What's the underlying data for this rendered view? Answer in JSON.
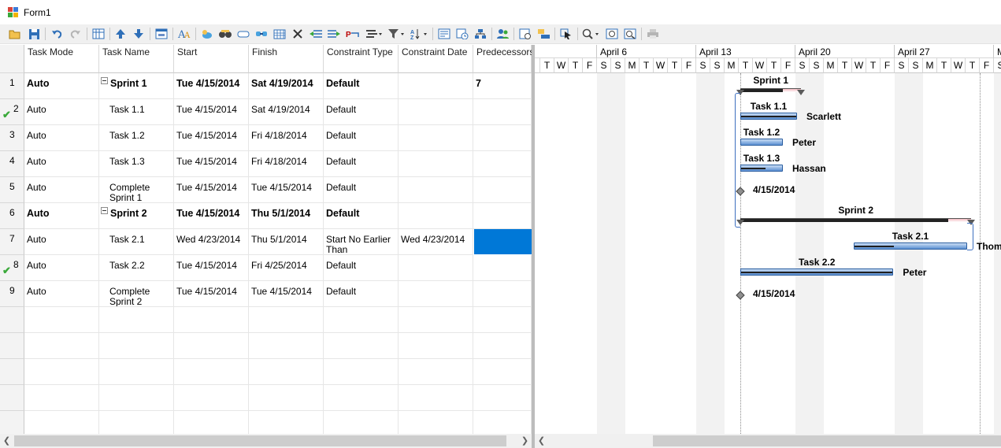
{
  "window": {
    "title": "Form1",
    "icon": "form-window-icon"
  },
  "toolbar": {
    "buttons": [
      "open-icon",
      "save-icon",
      "undo-icon",
      "redo-icon",
      "grid-columns-icon",
      "move-up-icon",
      "move-down-icon",
      "window-icon",
      "font-icon",
      "cloud-icon",
      "binoculars-icon",
      "capsule-icon",
      "link-tasks-icon",
      "calendar-icon",
      "delete-icon",
      "outdent-icon",
      "indent-icon",
      "resource-icon",
      "bar-style-icon",
      "filter-icon",
      "sort-icon",
      "report-icon",
      "schedule-icon",
      "org-icon",
      "users-icon",
      "task-info-icon",
      "notes-icon",
      "pointer-icon",
      "zoom-icon",
      "zoom-fit-icon",
      "zoom-time-icon",
      "print-icon"
    ]
  },
  "grid": {
    "columns": [
      "Task Mode",
      "Task Name",
      "Start",
      "Finish",
      "Constraint Type",
      "Constraint Date",
      "Predecessors"
    ],
    "rows": [
      {
        "num": "1",
        "mode": "Auto",
        "name": "Sprint 1",
        "start": "Tue 4/15/2014",
        "finish": "Sat 4/19/2014",
        "ctype": "Default",
        "cdate": "",
        "pred": "7",
        "summary": true,
        "check": false,
        "indent": false
      },
      {
        "num": "2",
        "mode": "Auto",
        "name": "Task 1.1",
        "start": "Tue 4/15/2014",
        "finish": "Sat 4/19/2014",
        "ctype": "Default",
        "cdate": "",
        "pred": "",
        "summary": false,
        "check": true,
        "indent": true
      },
      {
        "num": "3",
        "mode": "Auto",
        "name": "Task 1.2",
        "start": "Tue 4/15/2014",
        "finish": "Fri 4/18/2014",
        "ctype": "Default",
        "cdate": "",
        "pred": "",
        "summary": false,
        "check": false,
        "indent": true
      },
      {
        "num": "4",
        "mode": "Auto",
        "name": "Task 1.3",
        "start": "Tue 4/15/2014",
        "finish": "Fri 4/18/2014",
        "ctype": "Default",
        "cdate": "",
        "pred": "",
        "summary": false,
        "check": false,
        "indent": true
      },
      {
        "num": "5",
        "mode": "Auto",
        "name": "Complete Sprint 1",
        "start": "Tue 4/15/2014",
        "finish": "Tue 4/15/2014",
        "ctype": "Default",
        "cdate": "",
        "pred": "",
        "summary": false,
        "check": false,
        "indent": true
      },
      {
        "num": "6",
        "mode": "Auto",
        "name": "Sprint 2",
        "start": "Tue 4/15/2014",
        "finish": "Thu 5/1/2014",
        "ctype": "Default",
        "cdate": "",
        "pred": "",
        "summary": true,
        "check": false,
        "indent": false
      },
      {
        "num": "7",
        "mode": "Auto",
        "name": "Task 2.1",
        "start": "Wed 4/23/2014",
        "finish": "Thu 5/1/2014",
        "ctype": "Start No Earlier Than",
        "cdate": "Wed 4/23/2014",
        "pred": "",
        "summary": false,
        "check": false,
        "indent": true,
        "selected": true
      },
      {
        "num": "8",
        "mode": "Auto",
        "name": "Task 2.2",
        "start": "Tue 4/15/2014",
        "finish": "Fri 4/25/2014",
        "ctype": "Default",
        "cdate": "",
        "pred": "",
        "summary": false,
        "check": true,
        "indent": true
      },
      {
        "num": "9",
        "mode": "Auto",
        "name": "Complete Sprint 2",
        "start": "Tue 4/15/2014",
        "finish": "Tue 4/15/2014",
        "ctype": "Default",
        "cdate": "",
        "pred": "",
        "summary": false,
        "check": false,
        "indent": true
      }
    ]
  },
  "gantt": {
    "weeks": [
      "",
      "April 6",
      "April 13",
      "April 20",
      "April 27",
      "M"
    ],
    "day_letters": [
      "T",
      "W",
      "T",
      "F",
      "S",
      "S",
      "M",
      "T",
      "W",
      "T",
      "F",
      "S",
      "S",
      "M",
      "T",
      "W",
      "T",
      "F",
      "S",
      "S",
      "M",
      "T",
      "W",
      "T",
      "F",
      "S",
      "S",
      "M",
      "T",
      "W",
      "T",
      "F",
      "S",
      "S"
    ],
    "items": [
      {
        "label": "Sprint 1",
        "type": "summary",
        "progress": 0.7
      },
      {
        "label": "Task 1.1",
        "type": "task",
        "progress": 1.0,
        "resource": "Scarlett"
      },
      {
        "label": "Task 1.2",
        "type": "task",
        "progress": 0.0,
        "resource": "Peter"
      },
      {
        "label": "Task 1.3",
        "type": "task",
        "progress": 0.6,
        "resource": "Hassan"
      },
      {
        "label": "4/15/2014",
        "type": "milestone"
      },
      {
        "label": "Sprint 2",
        "type": "summary",
        "progress": 0.9
      },
      {
        "label": "Task 2.1",
        "type": "task",
        "progress": 0.35,
        "resource": "Thomas"
      },
      {
        "label": "Task 2.2",
        "type": "task",
        "progress": 1.0,
        "resource": "Peter"
      },
      {
        "label": "4/15/2014",
        "type": "milestone"
      }
    ],
    "colors": {
      "bar": "#5b8fd2",
      "bar_border": "#2a5d9f",
      "summary": "#f4b9c0",
      "selection": "#0078d7",
      "link": "#3d6fbf",
      "check": "#3aa93a"
    }
  }
}
